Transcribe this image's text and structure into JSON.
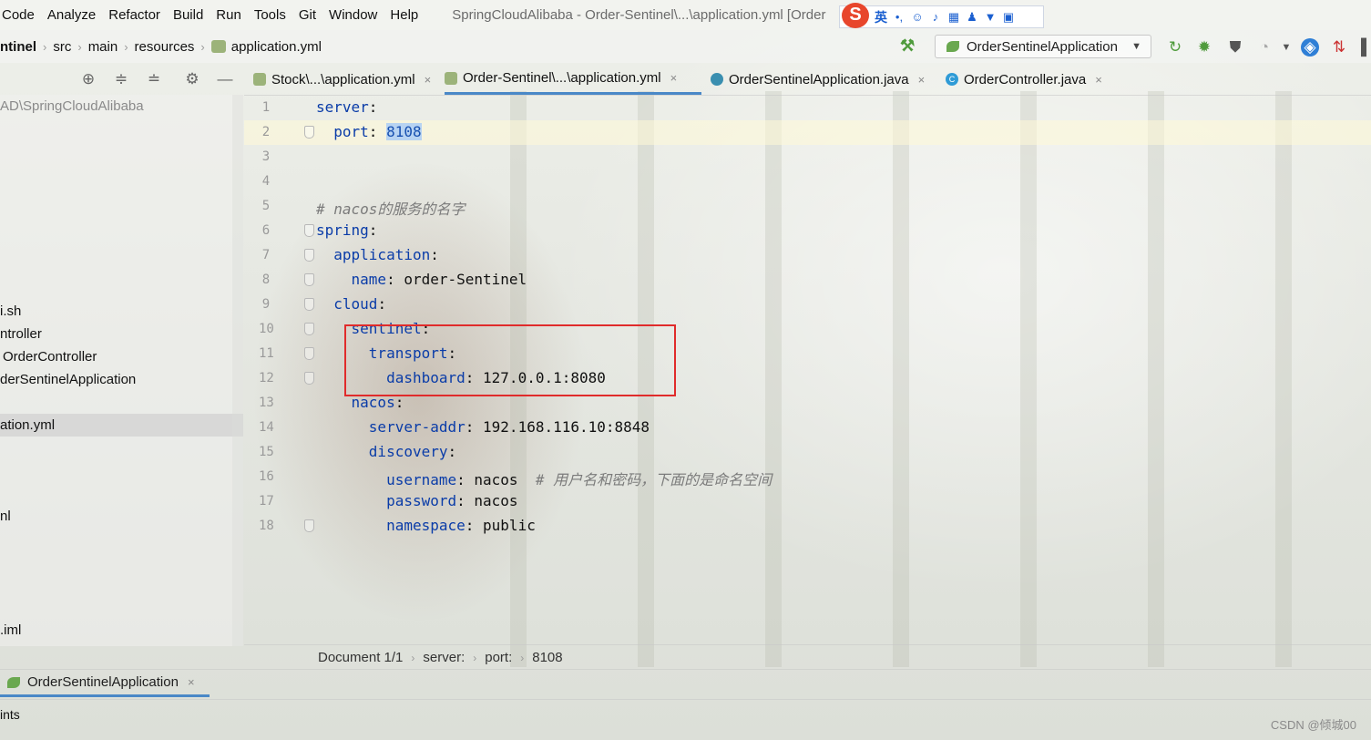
{
  "menu": {
    "items": [
      "Code",
      "Analyze",
      "Refactor",
      "Build",
      "Run",
      "Tools",
      "Git",
      "Window",
      "Help"
    ],
    "window_title": "SpringCloudAlibaba - Order-Sentinel\\...\\application.yml [Order"
  },
  "ime": {
    "logo": "S",
    "lang": "英",
    "punct": "•,"
  },
  "breadcrumb": {
    "items": [
      "ntinel",
      "src",
      "main",
      "resources",
      "application.yml"
    ]
  },
  "run_config": {
    "label": "OrderSentinelApplication"
  },
  "project_tree": {
    "items": [
      "AD\\SpringCloudAlibaba",
      "i.sh",
      "ntroller",
      "OrderController",
      "derSentinelApplication",
      "ation.yml",
      "nl",
      ".iml"
    ]
  },
  "tabs": [
    {
      "label": "Stock\\...\\application.yml",
      "close": "×"
    },
    {
      "label": "Order-Sentinel\\...\\application.yml",
      "close": "×"
    },
    {
      "label": "OrderSentinelApplication.java",
      "close": "×"
    },
    {
      "label": "OrderController.java",
      "close": "×"
    }
  ],
  "editor": {
    "line_numbers": [
      "1",
      "2",
      "3",
      "4",
      "5",
      "6",
      "7",
      "8",
      "9",
      "10",
      "11",
      "12",
      "13",
      "14",
      "15",
      "16",
      "17",
      "18"
    ],
    "lines": {
      "l1_key": "server",
      "l2_key": "port",
      "l2_val": "8108",
      "l5_comment": "# nacos的服务的名字",
      "l6_key": "spring",
      "l7_key": "application",
      "l8_key": "name",
      "l8_val": "order-Sentinel",
      "l9_key": "cloud",
      "l10_key": "sentinel",
      "l11_key": "transport",
      "l12_key": "dashboard",
      "l12_val": "127.0.0.1:8080",
      "l13_key": "nacos",
      "l14_key": "server-addr",
      "l14_val": "192.168.116.10:8848",
      "l15_key": "discovery",
      "l16_key": "username",
      "l16_val": "nacos",
      "l16_comment": "# 用户名和密码，下面的是命名空间",
      "l17_key": "password",
      "l17_val": "nacos",
      "l18_key": "namespace",
      "l18_val": "public"
    }
  },
  "status": {
    "items": [
      "Document 1/1",
      "server:",
      "port:",
      "8108"
    ]
  },
  "run_panel": {
    "tab_label": "OrderSentinelApplication",
    "tab_close": "×",
    "bottom_label": "ints"
  },
  "watermark": "CSDN @倾城00",
  "colors": {
    "accent": "#4a88c7",
    "highlight_box": "#e02b2b",
    "yaml_key": "#0a3ca8"
  }
}
